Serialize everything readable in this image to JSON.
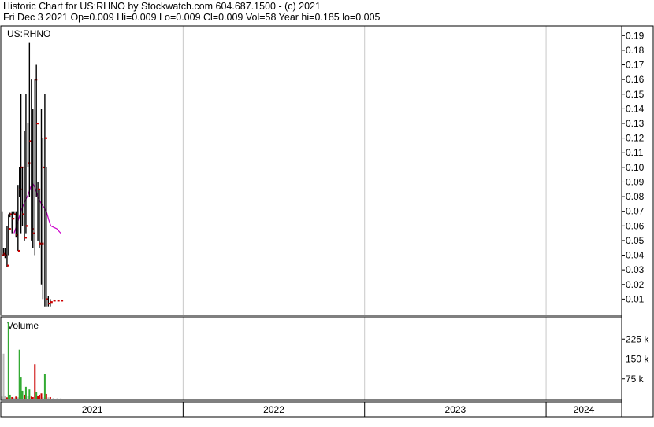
{
  "header": {
    "line1": "Historic Chart for US:RHNO by Stockwatch.com 604.687.1500 - (c) 2021",
    "line2": "Fri Dec  3 2021   Op=0.009  Hi=0.009  Lo=0.009  Cl=0.009  Vol=58  Year hi=0.185  lo=0.005"
  },
  "colors": {
    "price_bar": "#000000",
    "close_tick": "#cc0000",
    "moving_avg": "#cc00cc",
    "vol_up": "#33aa33",
    "vol_down": "#cc0000",
    "vol_flat": "#bbbbbb",
    "grid": "#c8c8c8"
  },
  "chart_data": [
    {
      "type": "ohlc",
      "panel_label": "US:RHNO",
      "ylim": [
        0.0,
        0.195
      ],
      "y_ticks": [
        "0.19",
        "0.18",
        "0.17",
        "0.16",
        "0.15",
        "0.14",
        "0.13",
        "0.12",
        "0.11",
        "0.10",
        "0.09",
        "0.08",
        "0.07",
        "0.06",
        "0.05",
        "0.04",
        "0.03",
        "0.02",
        "0.01"
      ],
      "x_year_labels": [
        "2021",
        "2022",
        "2023",
        "2024"
      ],
      "x_start": "2021-01-01",
      "x_end": "2024-06-01",
      "bars": [
        {
          "date": "2021-01-02",
          "high": 0.07,
          "low": 0.04,
          "close": 0.04
        },
        {
          "date": "2021-01-05",
          "high": 0.045,
          "low": 0.04,
          "close": 0.041
        },
        {
          "date": "2021-01-08",
          "high": 0.045,
          "low": 0.038,
          "close": 0.04
        },
        {
          "date": "2021-01-12",
          "high": 0.06,
          "low": 0.032,
          "close": 0.033
        },
        {
          "date": "2021-01-15",
          "high": 0.068,
          "low": 0.04,
          "close": 0.058
        },
        {
          "date": "2021-01-18",
          "high": 0.069,
          "low": 0.066,
          "close": 0.068
        },
        {
          "date": "2021-01-22",
          "high": 0.07,
          "low": 0.055,
          "close": 0.065
        },
        {
          "date": "2021-01-26",
          "high": 0.07,
          "low": 0.068,
          "close": 0.068
        },
        {
          "date": "2021-01-30",
          "high": 0.07,
          "low": 0.052,
          "close": 0.054
        },
        {
          "date": "2021-02-03",
          "high": 0.088,
          "low": 0.043,
          "close": 0.043
        },
        {
          "date": "2021-02-06",
          "high": 0.1,
          "low": 0.08,
          "close": 0.085
        },
        {
          "date": "2021-02-09",
          "high": 0.15,
          "low": 0.055,
          "close": 0.1
        },
        {
          "date": "2021-02-12",
          "high": 0.1,
          "low": 0.06,
          "close": 0.068
        },
        {
          "date": "2021-02-16",
          "high": 0.125,
          "low": 0.05,
          "close": 0.052
        },
        {
          "date": "2021-02-19",
          "high": 0.15,
          "low": 0.055,
          "close": 0.06
        },
        {
          "date": "2021-02-23",
          "high": 0.13,
          "low": 0.1,
          "close": 0.103
        },
        {
          "date": "2021-02-26",
          "high": 0.185,
          "low": 0.08,
          "close": 0.118
        },
        {
          "date": "2021-03-02",
          "high": 0.16,
          "low": 0.05,
          "close": 0.058
        },
        {
          "date": "2021-03-05",
          "high": 0.14,
          "low": 0.045,
          "close": 0.055
        },
        {
          "date": "2021-03-09",
          "high": 0.16,
          "low": 0.04,
          "close": 0.16
        },
        {
          "date": "2021-03-12",
          "high": 0.17,
          "low": 0.08,
          "close": 0.13
        },
        {
          "date": "2021-03-15",
          "high": 0.09,
          "low": 0.05,
          "close": 0.085
        },
        {
          "date": "2021-03-18",
          "high": 0.085,
          "low": 0.045,
          "close": 0.048
        },
        {
          "date": "2021-03-22",
          "high": 0.14,
          "low": 0.02,
          "close": 0.048
        },
        {
          "date": "2021-03-25",
          "high": 0.12,
          "low": 0.01,
          "close": 0.1
        },
        {
          "date": "2021-03-29",
          "high": 0.15,
          "low": 0.005,
          "close": 0.12
        },
        {
          "date": "2021-04-01",
          "high": 0.1,
          "low": 0.005,
          "close": 0.01
        },
        {
          "date": "2021-04-05",
          "high": 0.012,
          "low": 0.005,
          "close": 0.007
        },
        {
          "date": "2021-04-09",
          "high": 0.01,
          "low": 0.005,
          "close": 0.008
        },
        {
          "date": "2021-04-15",
          "high": 0.009,
          "low": 0.009,
          "close": 0.009
        },
        {
          "date": "2021-04-23",
          "high": 0.009,
          "low": 0.009,
          "close": 0.009
        },
        {
          "date": "2021-04-30",
          "high": 0.009,
          "low": 0.009,
          "close": 0.009
        }
      ],
      "moving_average": [
        {
          "date": "2021-01-26",
          "value": 0.055
        },
        {
          "date": "2021-02-03",
          "value": 0.063
        },
        {
          "date": "2021-02-09",
          "value": 0.07
        },
        {
          "date": "2021-02-16",
          "value": 0.076
        },
        {
          "date": "2021-02-23",
          "value": 0.081
        },
        {
          "date": "2021-03-01",
          "value": 0.087
        },
        {
          "date": "2021-03-05",
          "value": 0.089
        },
        {
          "date": "2021-03-09",
          "value": 0.086
        },
        {
          "date": "2021-03-15",
          "value": 0.08
        },
        {
          "date": "2021-03-22",
          "value": 0.075
        },
        {
          "date": "2021-03-29",
          "value": 0.072
        },
        {
          "date": "2021-04-02",
          "value": 0.069
        },
        {
          "date": "2021-04-06",
          "value": 0.064
        },
        {
          "date": "2021-04-10",
          "value": 0.06
        },
        {
          "date": "2021-04-16",
          "value": 0.059
        },
        {
          "date": "2021-04-22",
          "value": 0.058
        },
        {
          "date": "2021-04-30",
          "value": 0.055
        }
      ]
    },
    {
      "type": "bar",
      "panel_label": "Volume",
      "ylim": [
        0,
        300000
      ],
      "y_ticks": [
        {
          "value": 225000,
          "label": "225 k"
        },
        {
          "value": 150000,
          "label": "150 k"
        },
        {
          "value": 75000,
          "label": "75 k"
        }
      ],
      "bars": [
        {
          "date": "2021-01-02",
          "volume": 8000,
          "dir": "flat"
        },
        {
          "date": "2021-01-05",
          "volume": 170000,
          "dir": "flat"
        },
        {
          "date": "2021-01-08",
          "volume": 12000,
          "dir": "flat"
        },
        {
          "date": "2021-01-12",
          "volume": 5000,
          "dir": "down"
        },
        {
          "date": "2021-01-15",
          "volume": 290000,
          "dir": "up"
        },
        {
          "date": "2021-01-18",
          "volume": 15000,
          "dir": "up"
        },
        {
          "date": "2021-01-22",
          "volume": 6000,
          "dir": "down"
        },
        {
          "date": "2021-01-26",
          "volume": 4000,
          "dir": "flat"
        },
        {
          "date": "2021-01-30",
          "volume": 8000,
          "dir": "down"
        },
        {
          "date": "2021-02-03",
          "volume": 5000,
          "dir": "flat"
        },
        {
          "date": "2021-02-06",
          "volume": 185000,
          "dir": "up"
        },
        {
          "date": "2021-02-09",
          "volume": 80000,
          "dir": "up"
        },
        {
          "date": "2021-02-12",
          "volume": 30000,
          "dir": "up"
        },
        {
          "date": "2021-02-16",
          "volume": 15000,
          "dir": "down"
        },
        {
          "date": "2021-02-19",
          "volume": 45000,
          "dir": "up"
        },
        {
          "date": "2021-02-23",
          "volume": 10000,
          "dir": "flat"
        },
        {
          "date": "2021-02-26",
          "volume": 35000,
          "dir": "up"
        },
        {
          "date": "2021-03-02",
          "volume": 8000,
          "dir": "down"
        },
        {
          "date": "2021-03-05",
          "volume": 6000,
          "dir": "down"
        },
        {
          "date": "2021-03-09",
          "volume": 130000,
          "dir": "down"
        },
        {
          "date": "2021-03-12",
          "volume": 25000,
          "dir": "up"
        },
        {
          "date": "2021-03-15",
          "volume": 12000,
          "dir": "down"
        },
        {
          "date": "2021-03-18",
          "volume": 15000,
          "dir": "down"
        },
        {
          "date": "2021-03-22",
          "volume": 20000,
          "dir": "down"
        },
        {
          "date": "2021-03-25",
          "volume": 5000,
          "dir": "flat"
        },
        {
          "date": "2021-03-29",
          "volume": 95000,
          "dir": "up"
        },
        {
          "date": "2021-04-01",
          "volume": 18000,
          "dir": "down"
        },
        {
          "date": "2021-04-05",
          "volume": 5000,
          "dir": "flat"
        },
        {
          "date": "2021-04-09",
          "volume": 6000,
          "dir": "down"
        },
        {
          "date": "2021-04-15",
          "volume": 2000,
          "dir": "flat"
        },
        {
          "date": "2021-04-23",
          "volume": 1500,
          "dir": "flat"
        },
        {
          "date": "2021-04-30",
          "volume": 1000,
          "dir": "flat"
        }
      ]
    }
  ]
}
